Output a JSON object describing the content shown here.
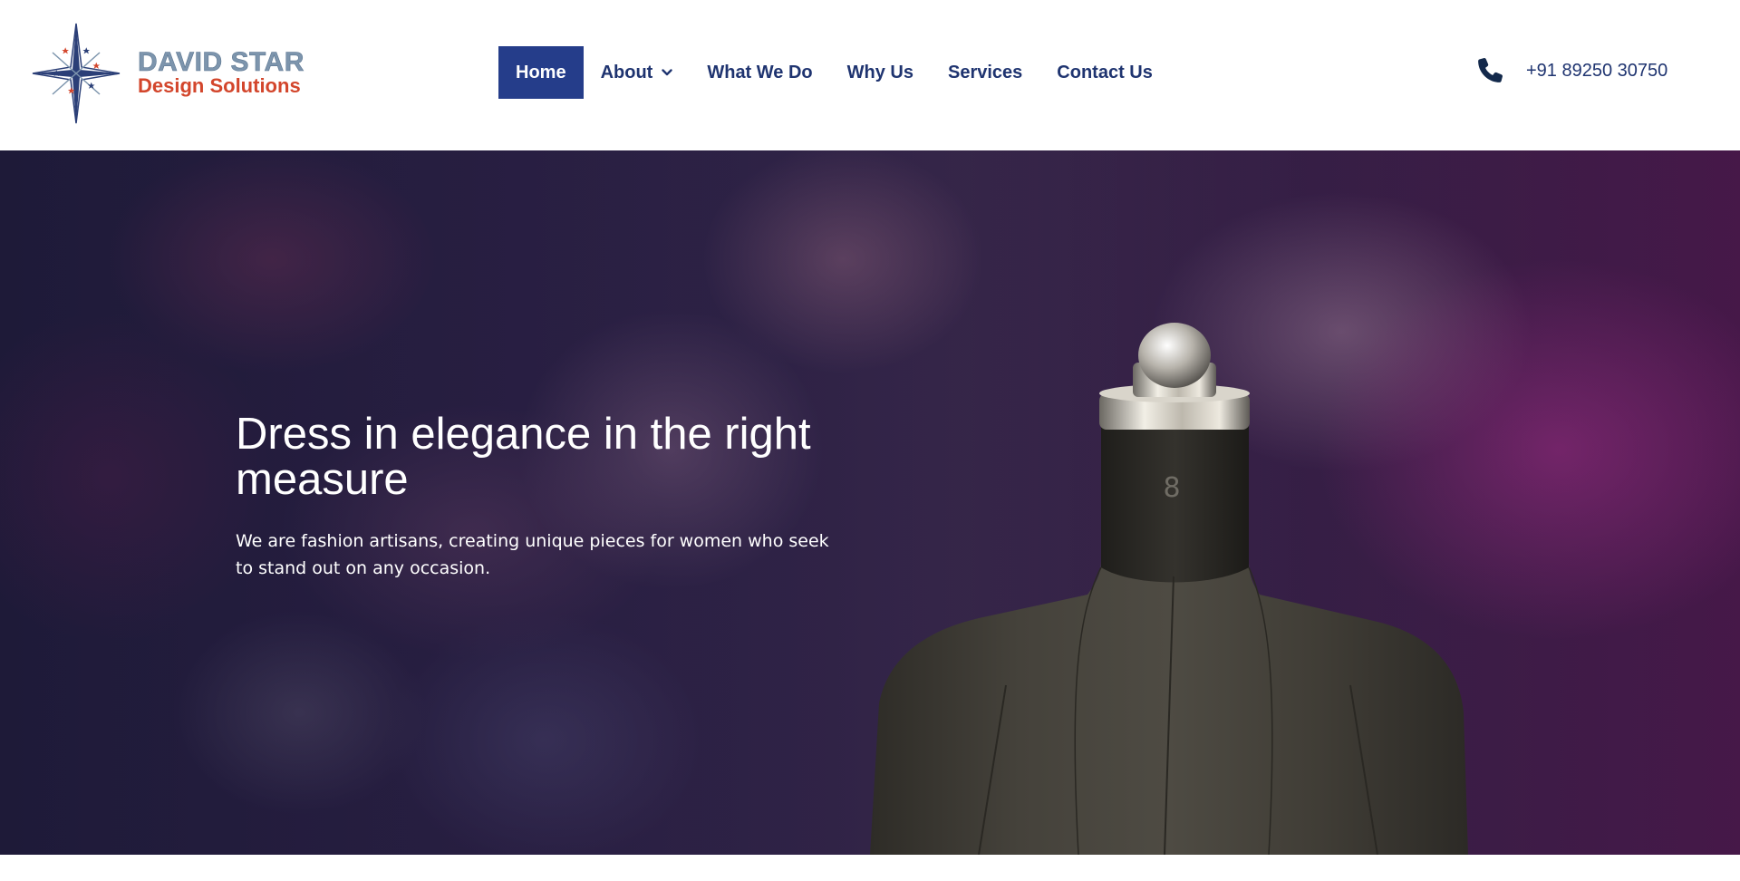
{
  "brand": {
    "line1": "DAVID STAR",
    "line2": "Design Solutions",
    "colors": {
      "primary": "#253d8a",
      "accent": "#d3462c",
      "steel": "#7d95ad"
    }
  },
  "nav": {
    "items": [
      {
        "label": "Home",
        "active": true
      },
      {
        "label": "About",
        "has_dropdown": true
      },
      {
        "label": "What We Do"
      },
      {
        "label": "Why Us"
      },
      {
        "label": "Services"
      },
      {
        "label": "Contact Us"
      }
    ]
  },
  "contact": {
    "icon": "phone-icon",
    "phone": "+91 89250 30750"
  },
  "hero": {
    "title": "Dress in elegance in the right measure",
    "subtitle": "We are fashion artisans, creating unique pieces for women who seek to stand out on any occasion.",
    "image": "dress-form-mannequin"
  }
}
